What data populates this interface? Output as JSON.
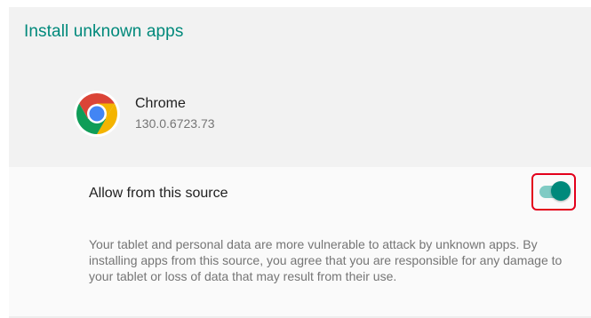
{
  "page": {
    "title": "Install unknown apps"
  },
  "app": {
    "name": "Chrome",
    "version": "130.0.6723.73",
    "icon": "chrome-icon"
  },
  "setting": {
    "label": "Allow from this source",
    "enabled": true,
    "description": "Your tablet and personal data are more vulnerable to attack by unknown apps. By installing apps from this source, you agree that you are responsible for any damage to your tablet or loss of data that may result from their use."
  },
  "colors": {
    "accent": "#00897b",
    "switch_track": "#80cbc4",
    "highlight": "#e3001b"
  }
}
